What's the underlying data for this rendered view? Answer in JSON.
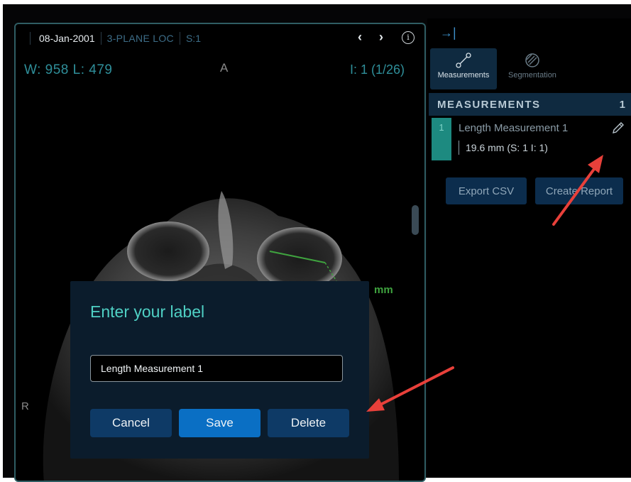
{
  "viewport": {
    "date": "08-Jan-2001",
    "series_description": "3-PLANE LOC",
    "slice": "S:1",
    "prev_icon": "chevron-left-icon",
    "next_icon": "chevron-right-icon",
    "info_icon": "info-icon",
    "window_level": "W: 958  L: 479",
    "orientation_top": "A",
    "orientation_left": "R",
    "image_index": "I: 1 (1/26)",
    "measurement_unit_label": "mm",
    "measurement_color": "#3fa33f"
  },
  "panel": {
    "collapse_icon": "collapse-right-icon",
    "tabs": [
      {
        "label": "Measurements",
        "icon": "ruler-icon",
        "active": true
      },
      {
        "label": "Segmentation",
        "icon": "hatched-circle-icon",
        "active": false
      }
    ],
    "header": {
      "title": "MEASUREMENTS",
      "count": "1"
    },
    "measurements": [
      {
        "index": "1",
        "label": "Length Measurement 1",
        "value": "19.6 mm (S: 1 I: 1)",
        "edit_icon": "pencil-icon"
      }
    ],
    "buttons": {
      "export": "Export CSV",
      "report": "Create Report"
    }
  },
  "dialog": {
    "title": "Enter your label",
    "input_value": "Length Measurement 1",
    "cancel": "Cancel",
    "save": "Save",
    "delete": "Delete"
  },
  "colors": {
    "accent_teal": "#4fd0c4",
    "primary_blue": "#0a6fc4",
    "annotation_arrow": "#e8403a"
  }
}
